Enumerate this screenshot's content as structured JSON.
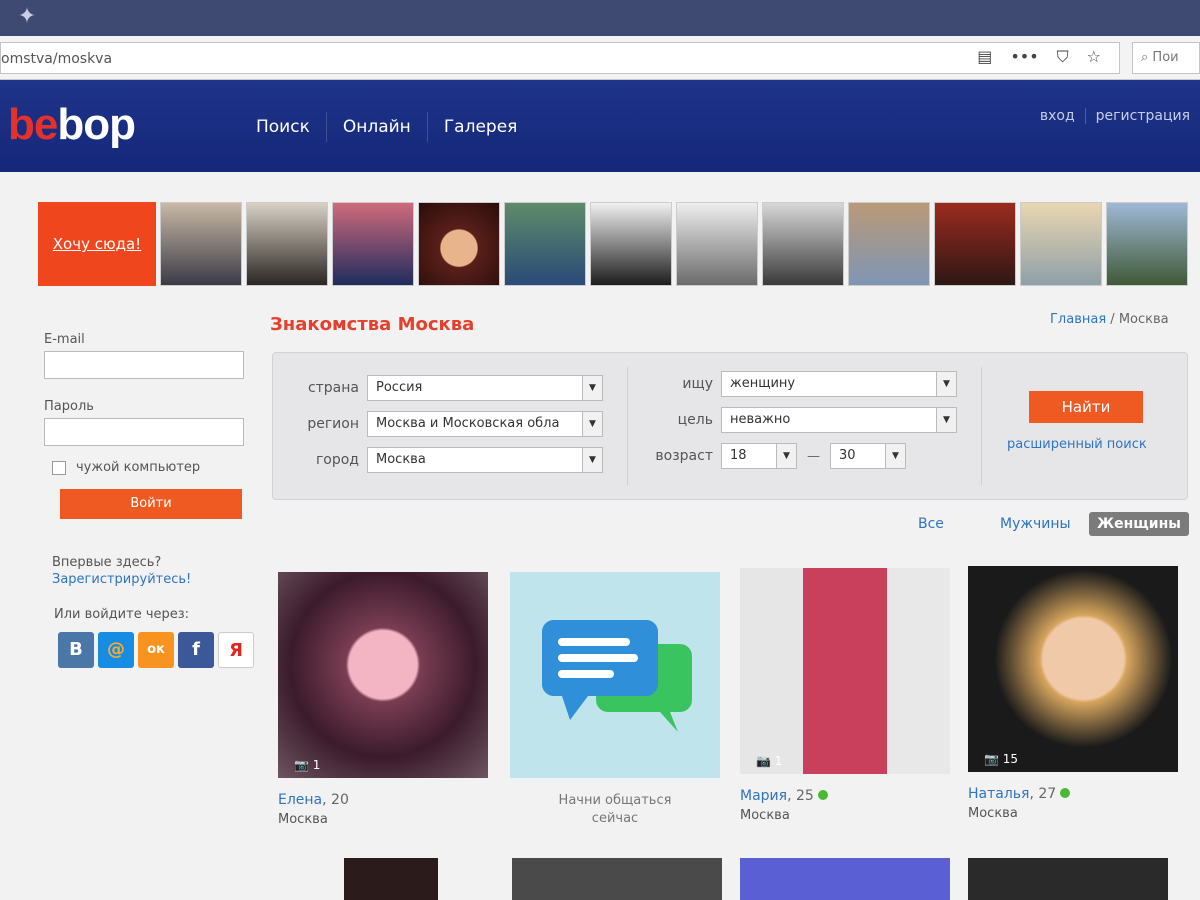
{
  "browser": {
    "url": "omstva/moskva",
    "search_placeholder": "Пои"
  },
  "header": {
    "logo_part1": "be",
    "logo_part2": "bop",
    "nav": [
      "Поиск",
      "Онлайн",
      "Галерея"
    ],
    "login_link": "вход",
    "register_link": "регистрация"
  },
  "strip": {
    "cta": "Хочу сюда!"
  },
  "login": {
    "email_label": "E-mail",
    "password_label": "Пароль",
    "remember_label": "чужой компьютер",
    "submit": "Войти",
    "first_time": "Впервые здесь?",
    "register_cta": "Зарегистрируйтесь!",
    "social_label": "Или войдите через:",
    "socials": [
      "В",
      "@",
      "ок",
      "f",
      "Я"
    ]
  },
  "main": {
    "title": "Знакомства Москва",
    "breadcrumb_home": "Главная",
    "breadcrumb_sep": " / ",
    "breadcrumb_current": "Москва"
  },
  "filters": {
    "country_label": "страна",
    "country_value": "Россия",
    "region_label": "регион",
    "region_value": "Москва и Московская обла",
    "city_label": "город",
    "city_value": "Москва",
    "seeking_label": "ищу",
    "seeking_value": "женщину",
    "goal_label": "цель",
    "goal_value": "неважно",
    "age_label": "возраст",
    "age_from": "18",
    "age_dash": "—",
    "age_to": "30",
    "find_button": "Найти",
    "advanced_link": "расширенный поиск"
  },
  "gender_tabs": {
    "all": "Все",
    "men": "Мужчины",
    "women": "Женщины"
  },
  "cards": [
    {
      "name": "Елена",
      "age": ", 20",
      "city": "Москва",
      "photos": "📷 1"
    },
    {
      "chat_text_1": "Начни общаться",
      "chat_text_2": "сейчас"
    },
    {
      "name": "Мария",
      "age": ", 25",
      "city": "Москва",
      "photos": "📷 1"
    },
    {
      "name": "Наталья",
      "age": ", 27",
      "city": "Москва",
      "photos": "📷 15"
    }
  ],
  "colors": {
    "header_blue": "#1e3489",
    "accent_orange": "#ef5a23",
    "link_blue": "#2f74c0",
    "title_red": "#e5402c"
  }
}
